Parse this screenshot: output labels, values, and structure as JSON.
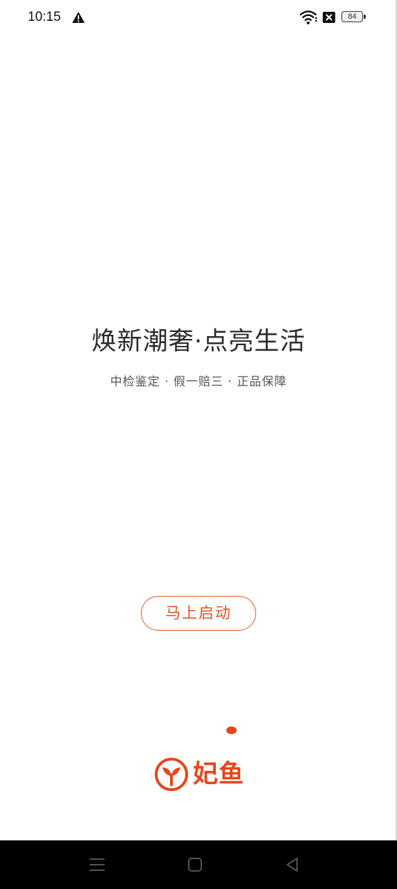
{
  "status_bar": {
    "time": "10:15",
    "battery_level": "84",
    "icons": [
      "warning-icon",
      "wifi-icon",
      "sim-disabled-icon",
      "battery-icon"
    ]
  },
  "splash": {
    "headline": "焕新潮奢·点亮生活",
    "subline": "中检鉴定 · 假一赔三 · 正品保障",
    "start_button_label": "马上启动",
    "page_indicator": {
      "total": 1,
      "active": 1
    }
  },
  "brand": {
    "name": "妃鱼",
    "logo_icon": "feiyu-logo-icon"
  },
  "colors": {
    "accent": "#e8461a",
    "button_border": "#e0541f",
    "headline": "#2b2b2b",
    "subline": "#555555",
    "nav_bar": "#000000"
  },
  "nav_bar": {
    "buttons": [
      "menu-icon",
      "home-icon",
      "back-icon"
    ]
  }
}
